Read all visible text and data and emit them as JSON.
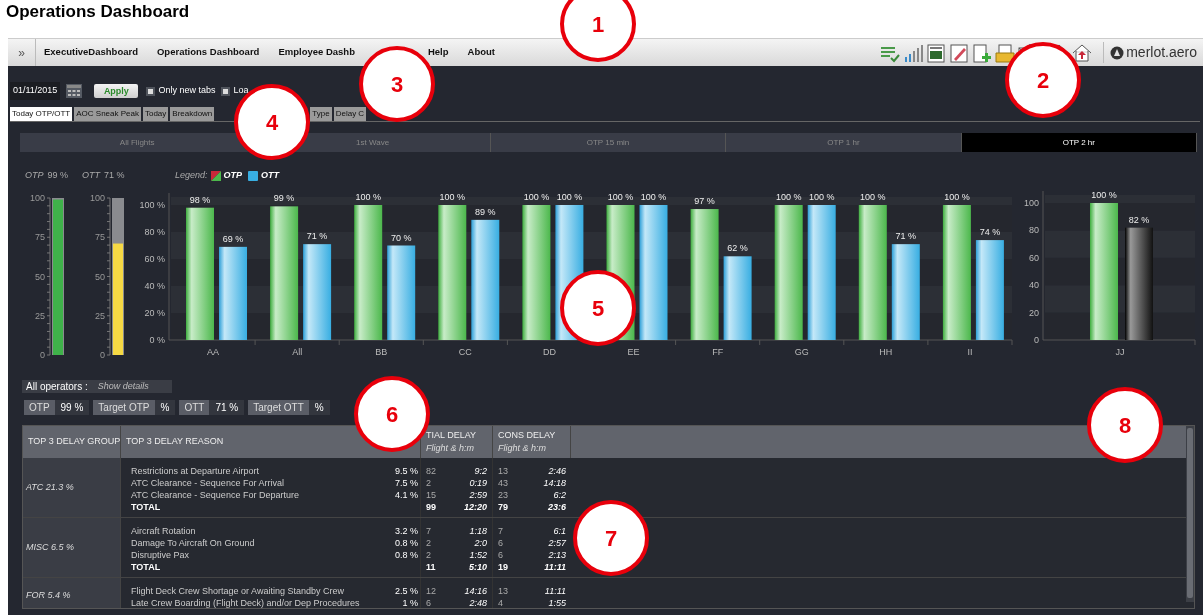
{
  "page_title": "Operations Dashboard",
  "menu": {
    "toggle": "»",
    "items": [
      {
        "label": "ExecutiveDashboard"
      },
      {
        "label": "Operations Dashboard"
      },
      {
        "label": "Employee Dashb"
      },
      {
        "label": "Help"
      },
      {
        "label": "About"
      }
    ]
  },
  "logo": "merlot.aero",
  "toolbar": {
    "date": "01/11/2015",
    "apply": "Apply",
    "options": [
      {
        "label": "Only new tabs",
        "checked": true
      },
      {
        "label": "Loa",
        "checked": true
      }
    ]
  },
  "tabs": [
    {
      "label": "Today OTP/OTT",
      "selected": true
    },
    {
      "label": "AOC Sneak Peak",
      "selected": false
    },
    {
      "label": "Today",
      "selected": false
    },
    {
      "label": "Breakdown",
      "selected": false
    },
    {
      "label": "Type",
      "selected": false
    },
    {
      "label": "Delay C",
      "selected": false
    }
  ],
  "subtabs": [
    {
      "label": "All Flights",
      "selected": false
    },
    {
      "label": "1st Wave",
      "selected": false
    },
    {
      "label": "OTP 15 min",
      "selected": false
    },
    {
      "label": "OTP 1 hr",
      "selected": false
    },
    {
      "label": "OTP 2 hr",
      "selected": true
    }
  ],
  "legend_label": "Legend:",
  "gauges": [
    {
      "label": "OTP",
      "reading": "99 %",
      "level": 0.99,
      "color": "#3fb24a",
      "ticks": [
        "100",
        "75",
        "50",
        "25",
        "0"
      ]
    },
    {
      "label": "OTT",
      "reading": "71 %",
      "level": 0.71,
      "color": "#f6d944",
      "ticks": [
        "100",
        "75",
        "50",
        "25",
        "0"
      ]
    }
  ],
  "chart_data": {
    "type": "bar",
    "categories": [
      "AA",
      "All",
      "BB",
      "CC",
      "DD",
      "EE",
      "FF",
      "GG",
      "HH",
      "II"
    ],
    "series": [
      {
        "name": "OTP",
        "color": "#4cb84c",
        "values": [
          98,
          99,
          100,
          100,
          100,
          100,
          97,
          100,
          100,
          100
        ],
        "value_labels": [
          "98 %",
          "99 %",
          "100 %",
          "100 %",
          "100 %",
          "100 %",
          "97 %",
          "100 %",
          "100 %",
          "100 %"
        ]
      },
      {
        "name": "OTT",
        "color": "#38aee2",
        "values": [
          69,
          71,
          70,
          89,
          100,
          100,
          62,
          100,
          71,
          74
        ],
        "value_labels": [
          "69 %",
          "71 %",
          "70 %",
          "89 %",
          "100 %",
          "100 %",
          "62 %",
          "100 %",
          "71 %",
          "74 %"
        ]
      }
    ],
    "ylim": [
      0,
      100
    ],
    "yticks": [
      {
        "value": 0,
        "label": "0 %"
      },
      {
        "value": 20,
        "label": "20 %"
      },
      {
        "value": 40,
        "label": "40 %"
      },
      {
        "value": 60,
        "label": "60 %"
      },
      {
        "value": 80,
        "label": "80 %"
      },
      {
        "value": 100,
        "label": "100 %"
      }
    ],
    "data_labels": true
  },
  "side_chart": {
    "chart_data": {
      "type": "bar",
      "categories": [
        "JJ"
      ],
      "series": [
        {
          "color": "#4cb84c",
          "values": [
            100
          ],
          "value_labels": [
            "100 %"
          ]
        },
        {
          "color": "#222222",
          "values": [
            82
          ],
          "value_labels": [
            "82 %"
          ]
        }
      ],
      "ylim": [
        0,
        100
      ],
      "yticks": [
        0,
        20,
        40,
        60,
        80,
        100
      ],
      "data_labels": true
    }
  },
  "operators": {
    "label": "All operators :",
    "link": "Show details"
  },
  "stats": [
    {
      "label": "OTP",
      "value": "99 %"
    },
    {
      "label": "Target OTP",
      "value": "%"
    },
    {
      "label": "OTT",
      "value": "71 %"
    },
    {
      "label": "Target OTT",
      "value": "%"
    }
  ],
  "delay_table": {
    "columns": [
      {
        "title": "TOP 3 DELAY GROUP"
      },
      {
        "title": "TOP 3 DELAY REASON"
      },
      {
        "title": "TIAL DELAY",
        "subtitle": "Flight & h:m"
      },
      {
        "title": "CONS DELAY",
        "subtitle": "Flight & h:m"
      }
    ],
    "groups": [
      {
        "group": "ATC 21.3 %",
        "rows": [
          {
            "reason": "Restrictions at Departure Airport",
            "share": "9.5 %",
            "init_flights": "82",
            "init_time": "9:2",
            "cons_flights": "13",
            "cons_time": "2:46"
          },
          {
            "reason": "ATC Clearance - Sequence For Arrival",
            "share": "7.5 %",
            "init_flights": "2",
            "init_time": "0:19",
            "cons_flights": "43",
            "cons_time": "14:18"
          },
          {
            "reason": "ATC Clearance - Sequence For Departure",
            "share": "4.1 %",
            "init_flights": "15",
            "init_time": "2:59",
            "cons_flights": "23",
            "cons_time": "6:2"
          }
        ],
        "total": {
          "label": "TOTAL",
          "init_flights": "99",
          "init_time": "12:20",
          "cons_flights": "79",
          "cons_time": "23:6"
        }
      },
      {
        "group": "MISC 6.5 %",
        "rows": [
          {
            "reason": "Aircraft Rotation",
            "share": "3.2 %",
            "init_flights": "7",
            "init_time": "1:18",
            "cons_flights": "7",
            "cons_time": "6:1"
          },
          {
            "reason": "Damage To Aircraft On Ground",
            "share": "0.8 %",
            "init_flights": "2",
            "init_time": "2:0",
            "cons_flights": "6",
            "cons_time": "2:57"
          },
          {
            "reason": "Disruptive Pax",
            "share": "0.8 %",
            "init_flights": "2",
            "init_time": "1:52",
            "cons_flights": "6",
            "cons_time": "2:13"
          }
        ],
        "total": {
          "label": "TOTAL",
          "init_flights": "11",
          "init_time": "5:10",
          "cons_flights": "19",
          "cons_time": "11:11"
        }
      },
      {
        "group": "FOR 5.4 %",
        "rows": [
          {
            "reason": "Flight Deck Crew Shortage or Awaiting Standby Crew",
            "share": "2.5 %",
            "init_flights": "12",
            "init_time": "14:16",
            "cons_flights": "13",
            "cons_time": "11:11"
          },
          {
            "reason": "Late Crew Boarding (Flight Deck) and/or Dep Procedures",
            "share": "1 %",
            "init_flights": "6",
            "init_time": "2:48",
            "cons_flights": "4",
            "cons_time": "1:55"
          }
        ]
      }
    ]
  },
  "callouts": [
    "1",
    "2",
    "3",
    "4",
    "5",
    "6",
    "7",
    "8"
  ]
}
